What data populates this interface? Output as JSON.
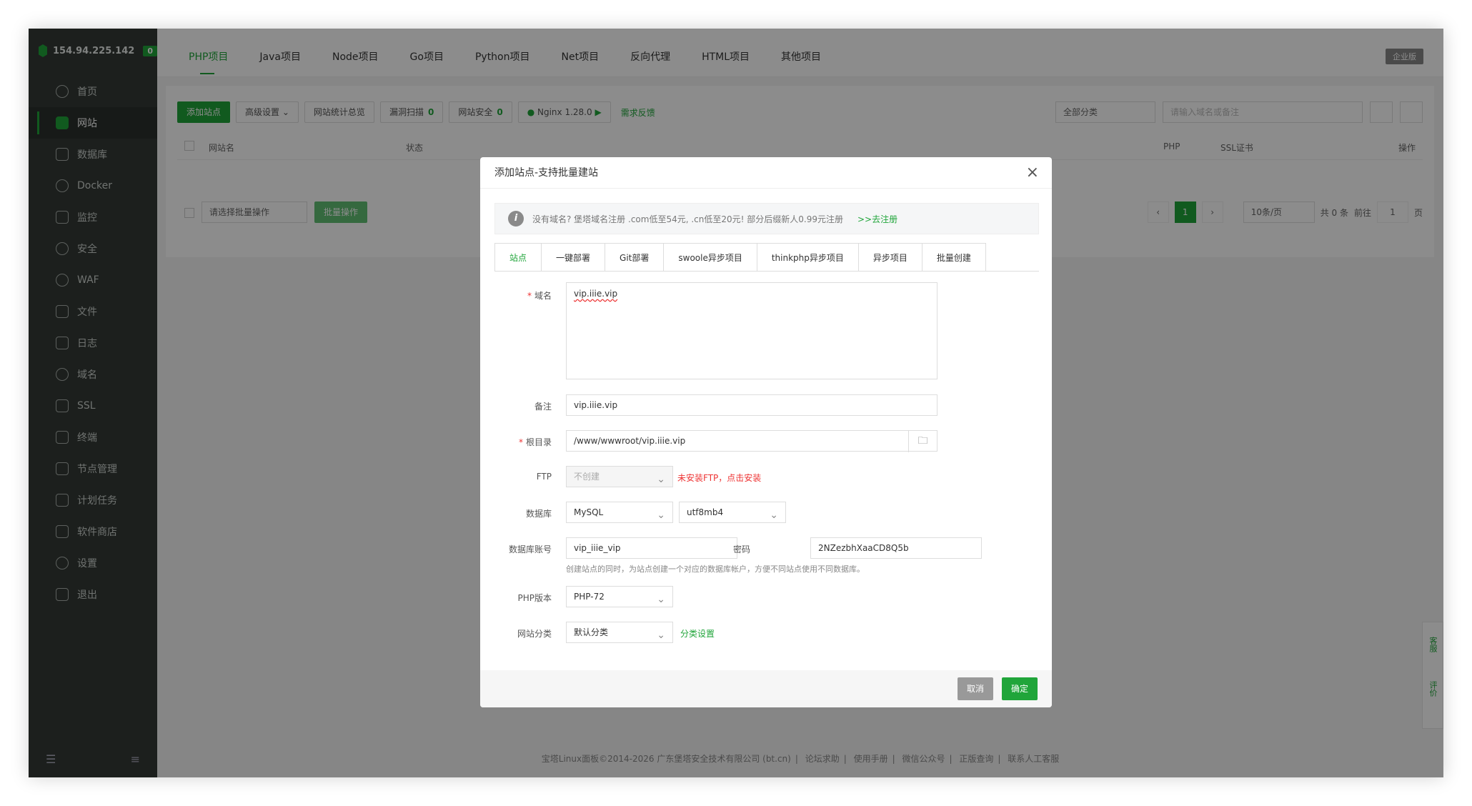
{
  "sidebar": {
    "ip": "154.94.225.142",
    "badge": "0",
    "items": [
      {
        "label": "首页",
        "icon": "home-icon"
      },
      {
        "label": "网站",
        "icon": "globe-icon"
      },
      {
        "label": "数据库",
        "icon": "database-icon"
      },
      {
        "label": "Docker",
        "icon": "docker-icon"
      },
      {
        "label": "监控",
        "icon": "monitor-icon"
      },
      {
        "label": "安全",
        "icon": "shield-icon"
      },
      {
        "label": "WAF",
        "icon": "waf-icon"
      },
      {
        "label": "文件",
        "icon": "folder-icon"
      },
      {
        "label": "日志",
        "icon": "log-icon"
      },
      {
        "label": "域名",
        "icon": "domain-icon"
      },
      {
        "label": "SSL",
        "icon": "ssl-icon"
      },
      {
        "label": "终端",
        "icon": "terminal-icon"
      },
      {
        "label": "节点管理",
        "icon": "node-icon"
      },
      {
        "label": "计划任务",
        "icon": "calendar-icon"
      },
      {
        "label": "软件商店",
        "icon": "store-icon"
      },
      {
        "label": "设置",
        "icon": "settings-icon"
      },
      {
        "label": "退出",
        "icon": "logout-icon"
      }
    ]
  },
  "topnav": {
    "tabs": [
      "PHP项目",
      "Java项目",
      "Node项目",
      "Go项目",
      "Python项目",
      "Net项目",
      "反向代理",
      "HTML项目",
      "其他项目"
    ],
    "enterprise": "企业版"
  },
  "toolbar": {
    "add_site": "添加站点",
    "advanced": "高级设置",
    "stats": "网站统计总览",
    "scan": "漏洞扫描",
    "scan_count": "0",
    "security": "网站安全",
    "security_count": "0",
    "nginx": "Nginx 1.28.0",
    "feedback": "需求反馈",
    "category": "全部分类",
    "search_placeholder": "请输入域名或备注"
  },
  "table": {
    "col_name": "网站名",
    "col_status": "状态",
    "col_php": "PHP",
    "col_ssl": "SSL证书",
    "col_ops": "操作",
    "batch_placeholder": "请选择批量操作",
    "batch_btn": "批量操作"
  },
  "pager": {
    "current": "1",
    "per_page": "10条/页",
    "total": "共 0 条",
    "goto": "前往",
    "goto_value": "1",
    "page_unit": "页"
  },
  "footer": {
    "copyright": "宝塔Linux面板©2014-2026 广东堡塔安全技术有限公司 (bt.cn)",
    "forum": "论坛求助",
    "manual": "使用手册",
    "wechat": "微信公众号",
    "verify": "正版查询",
    "support": "联系人工客服"
  },
  "float": {
    "service": "客服",
    "rate": "评价"
  },
  "modal": {
    "title": "添加站点-支持批量建站",
    "notice": "没有域名? 堡塔域名注册 .com低至54元, .cn低至20元! 部分后缀新人0.99元注册",
    "notice_link": ">>去注册",
    "tabs": [
      "站点",
      "一键部署",
      "Git部署",
      "swoole异步项目",
      "thinkphp异步项目",
      "异步项目",
      "批量创建"
    ],
    "domain_label": "域名",
    "domain_value": "vip.iiie.vip",
    "remark_label": "备注",
    "remark_value": "vip.iiie.vip",
    "root_label": "根目录",
    "root_value": "/www/wwwroot/vip.iiie.vip",
    "ftp_label": "FTP",
    "ftp_value": "不创建",
    "ftp_warn": "未安装FTP，点击安装",
    "db_label": "数据库",
    "db_type": "MySQL",
    "db_charset": "utf8mb4",
    "dbuser_label": "数据库账号",
    "dbuser_value": "vip_iiie_vip",
    "pwd_label": "密码",
    "pwd_value": "2NZezbhXaaCD8Q5b",
    "db_hint": "创建站点的同时，为站点创建一个对应的数据库帐户，方便不同站点使用不同数据库。",
    "php_label": "PHP版本",
    "php_value": "PHP-72",
    "cat_label": "网站分类",
    "cat_value": "默认分类",
    "cat_link": "分类设置",
    "cancel": "取消",
    "ok": "确定"
  }
}
